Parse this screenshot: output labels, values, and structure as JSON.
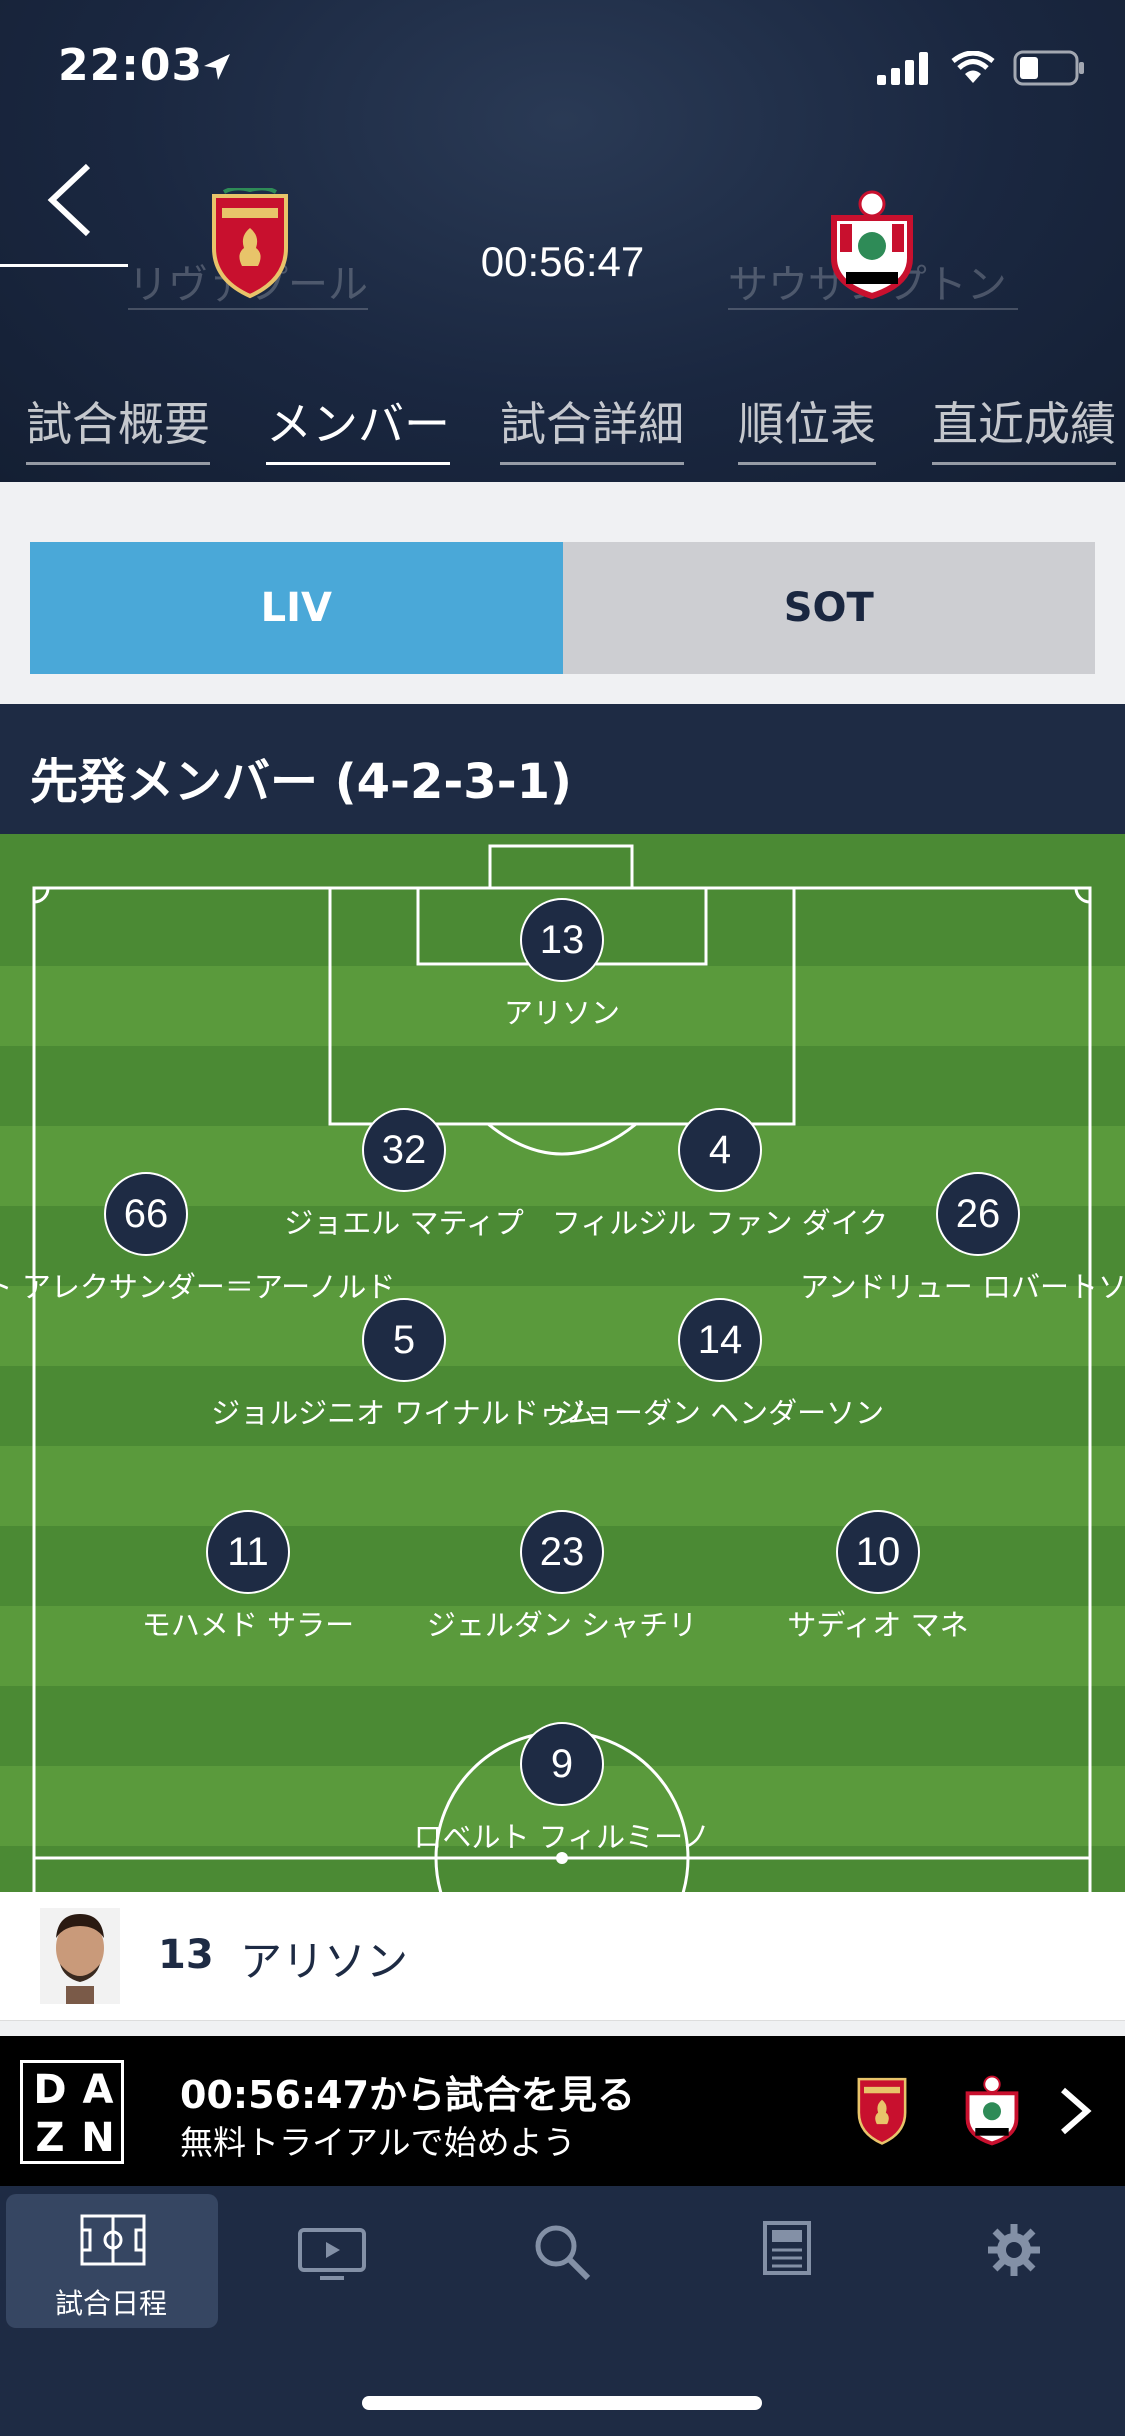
{
  "status": {
    "time": "22:03"
  },
  "header": {
    "home_team_name": "リヴァプール",
    "away_team_name": "サウサンプトン",
    "match_clock": "00:56:47"
  },
  "tabs": [
    {
      "label": "試合概要"
    },
    {
      "label": "メンバー"
    },
    {
      "label": "試合詳細"
    },
    {
      "label": "順位表"
    },
    {
      "label": "直近成績"
    }
  ],
  "team_toggle": {
    "home": "LIV",
    "away": "SOT"
  },
  "lineup": {
    "title": "先発メンバー (4-2-3-1)",
    "players": [
      {
        "number": "13",
        "name": "アリソン"
      },
      {
        "number": "32",
        "name": "ジョエル マティプ"
      },
      {
        "number": "4",
        "name": "フィルジル ファン ダイク"
      },
      {
        "number": "66",
        "name": "トレント アレクサンダー＝アーノルド"
      },
      {
        "number": "26",
        "name": "アンドリュー ロバートソン"
      },
      {
        "number": "5",
        "name": "ジョルジニオ ワイナルドゥム"
      },
      {
        "number": "14",
        "name": "ジョーダン ヘンダーソン"
      },
      {
        "number": "11",
        "name": "モハメド サラー"
      },
      {
        "number": "23",
        "name": "ジェルダン シャチリ"
      },
      {
        "number": "10",
        "name": "サディオ マネ"
      },
      {
        "number": "9",
        "name": "ロベルト フィルミーノ"
      }
    ]
  },
  "selected_player": {
    "number": "13",
    "name": "アリソン"
  },
  "promo": {
    "brand": "DAZN",
    "headline": "00:56:47から試合を見る",
    "subline": "無料トライアルで始めよう"
  },
  "bottom_nav": {
    "items": [
      {
        "label": "試合日程",
        "icon": "schedule-icon"
      },
      {
        "label": "",
        "icon": "tv-icon"
      },
      {
        "label": "",
        "icon": "search-icon"
      },
      {
        "label": "",
        "icon": "news-icon"
      },
      {
        "label": "",
        "icon": "settings-icon"
      }
    ]
  },
  "colors": {
    "header_bg": "#1a2740",
    "toggle_active": "#4aa8d8",
    "toggle_inactive": "#cdced2",
    "pitch_light": "#5a9a3c",
    "pitch_dark": "#4b8a34"
  }
}
